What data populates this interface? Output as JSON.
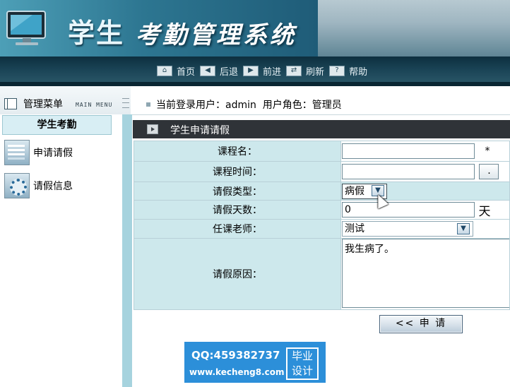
{
  "header": {
    "title_main": "学生",
    "title_accent": "考勤管理系统"
  },
  "topnav": {
    "items": [
      {
        "label": "首页",
        "icon": "home-icon"
      },
      {
        "label": "后退",
        "icon": "back-arrow-icon"
      },
      {
        "label": "前进",
        "icon": "forward-arrow-icon"
      },
      {
        "label": "刷新",
        "icon": "refresh-icon"
      },
      {
        "label": "帮助",
        "icon": "help-icon"
      }
    ]
  },
  "menu": {
    "title": "管理菜单",
    "subtitle": "MAIN MENU"
  },
  "user_bar": {
    "text": "当前登录用户：admin  用户角色：管理员"
  },
  "sidebar": {
    "section": "学生考勤",
    "items": [
      {
        "label": "申请请假",
        "icon": "calculator-icon"
      },
      {
        "label": "请假信息",
        "icon": "gear-icon"
      }
    ]
  },
  "content": {
    "title": "学生申请请假",
    "form": {
      "course_name_label": "课程名：",
      "course_name_value": "",
      "required_mark": "*",
      "course_time_label": "课程时间：",
      "course_time_value": "",
      "course_time_button": ".",
      "leave_type_label": "请假类型：",
      "leave_type_value": "病假",
      "leave_days_label": "请假天数：",
      "leave_days_value": "0",
      "leave_days_unit": "天",
      "teacher_label": "任课老师：",
      "teacher_value": "测试",
      "reason_label": "请假原因：",
      "reason_value": "我生病了。"
    },
    "submit_label": "<< 申 请"
  },
  "watermark": {
    "qq": "QQ:459382737",
    "url": "www.kecheng8.com",
    "badge_line1": "毕业",
    "badge_line2": "设计"
  },
  "colors": {
    "accent": "#2f3338",
    "label_bg": "#cde8ec",
    "sidebar_bar": "#a6d3de",
    "watermark_bg": "#2c8fd9"
  }
}
